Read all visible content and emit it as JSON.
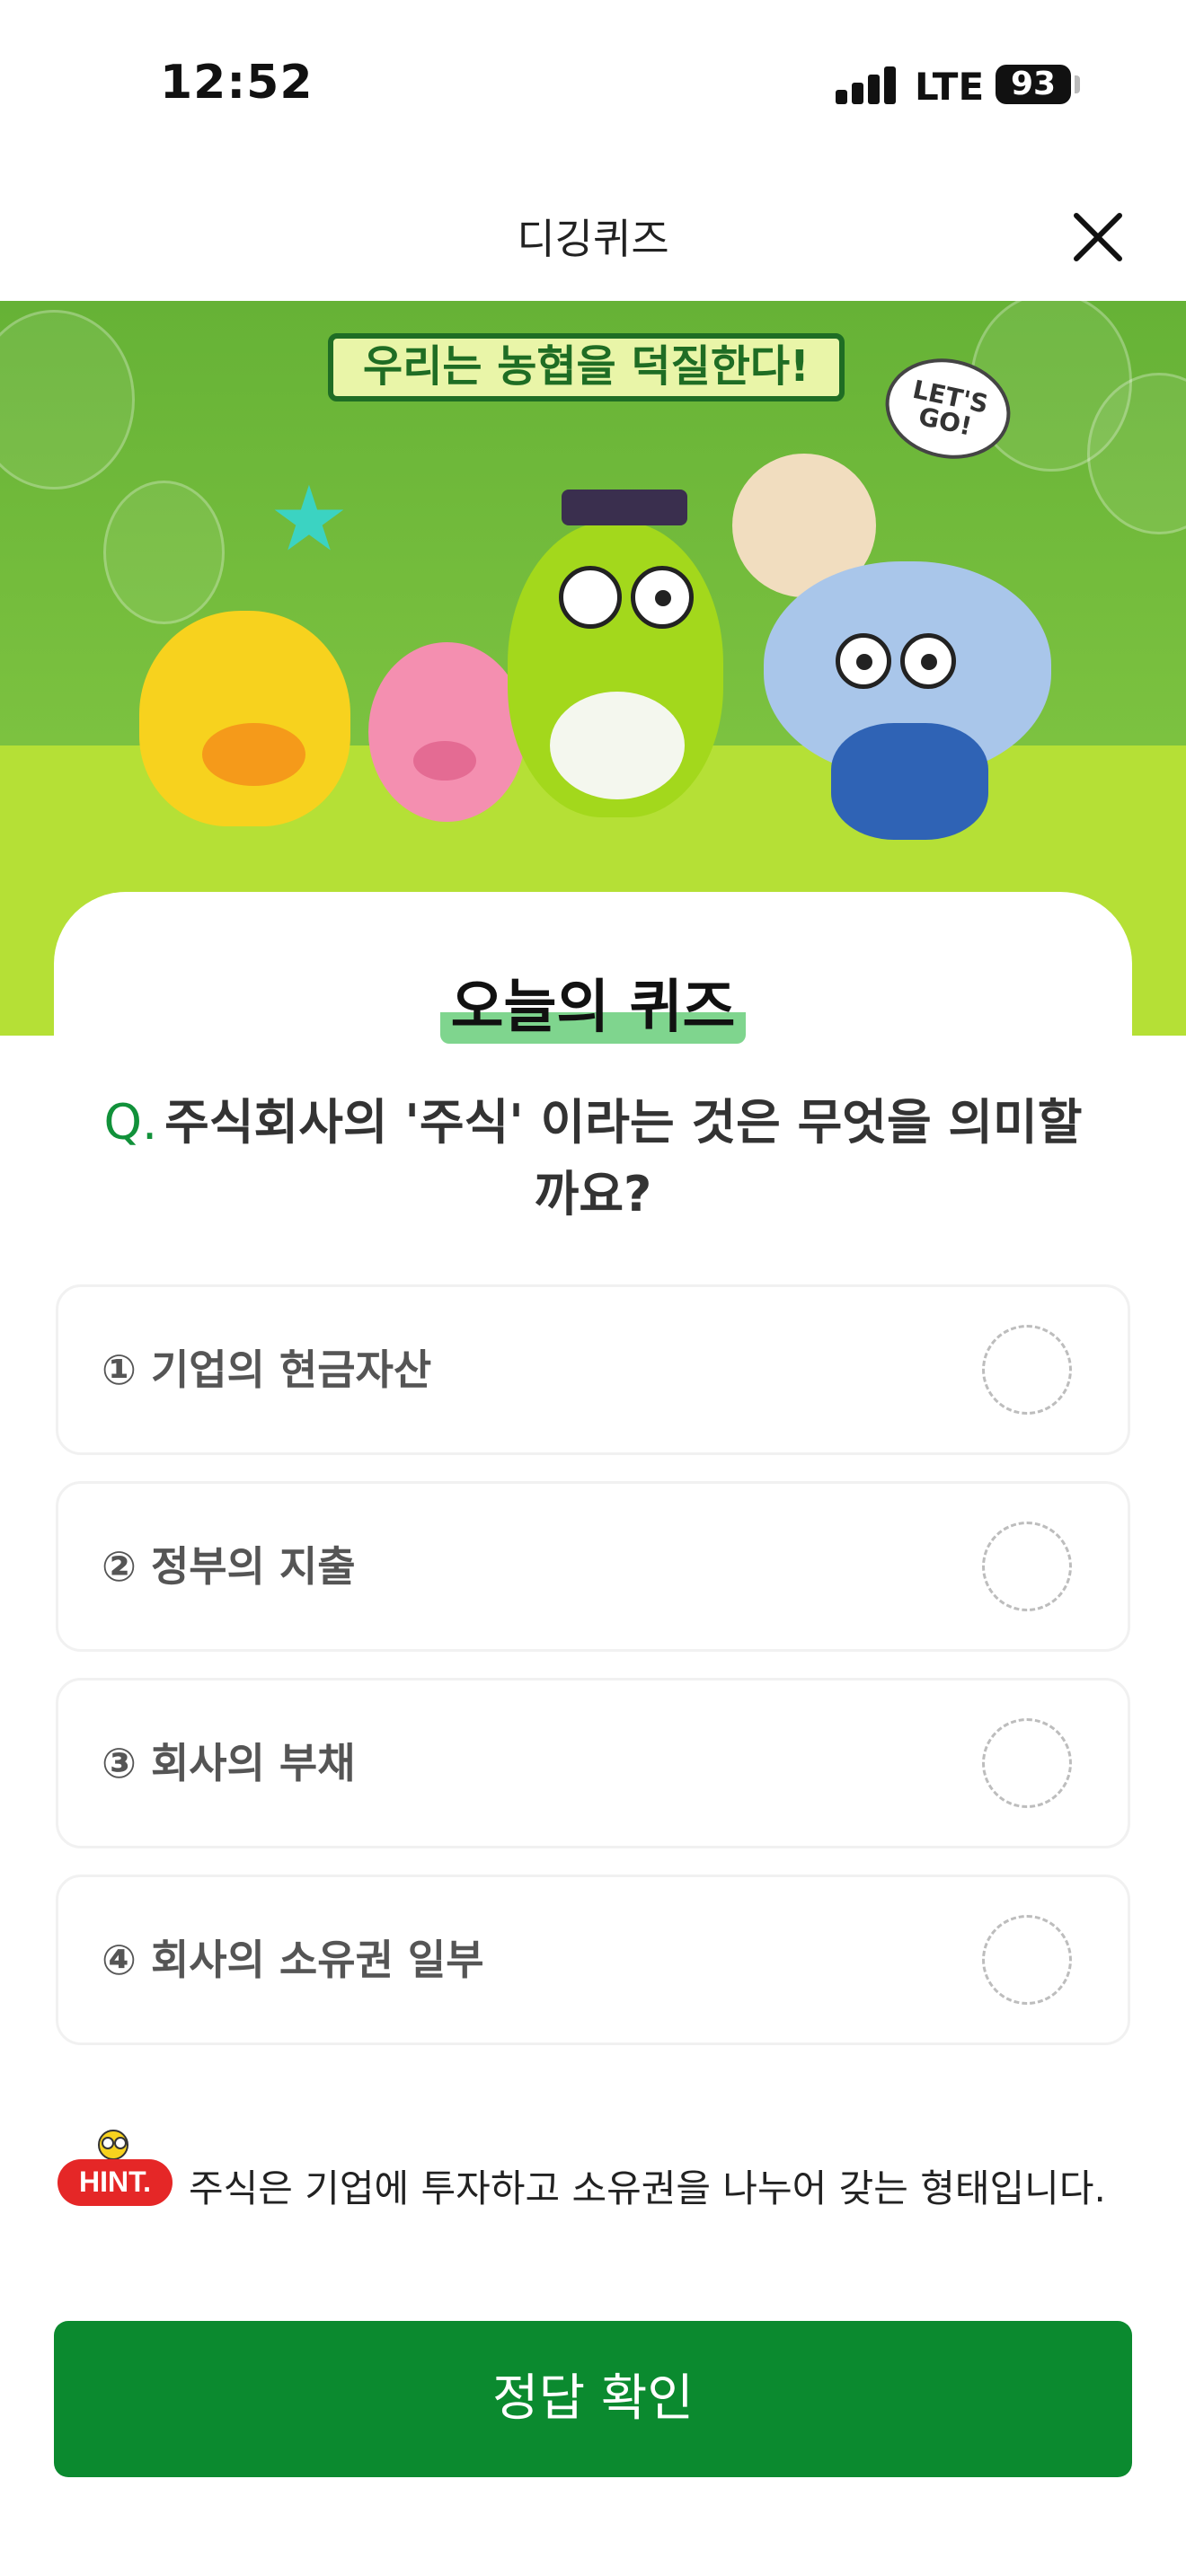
{
  "status_bar": {
    "time": "12:52",
    "network": "LTE",
    "battery": "93"
  },
  "header": {
    "title": "디깅퀴즈",
    "close_icon": "close-icon"
  },
  "banner": {
    "slogan": "우리는 농협을 덕질한다!",
    "speech_bubble": "LET'S GO!"
  },
  "quiz": {
    "section_title": "오늘의 퀴즈",
    "question_prefix": "Q.",
    "question": "주식회사의 '주식' 이라는 것은 무엇을 의미할까요?",
    "options": [
      {
        "label": "① 기업의 현금자산"
      },
      {
        "label": "② 정부의 지출"
      },
      {
        "label": "③ 회사의 부채"
      },
      {
        "label": "④ 회사의 소유권 일부"
      }
    ],
    "hint_badge": "HINT.",
    "hint_text": "주식은 기업에 투자하고 소유권을 나누어 갖는 형태입니다.",
    "confirm_button": "정답 확인"
  },
  "colors": {
    "accent_green": "#0b8a2f",
    "question_mark": "#11913a",
    "banner_green": "#7cc240",
    "banner_lime": "#b5e036",
    "hint_red": "#e52727"
  }
}
